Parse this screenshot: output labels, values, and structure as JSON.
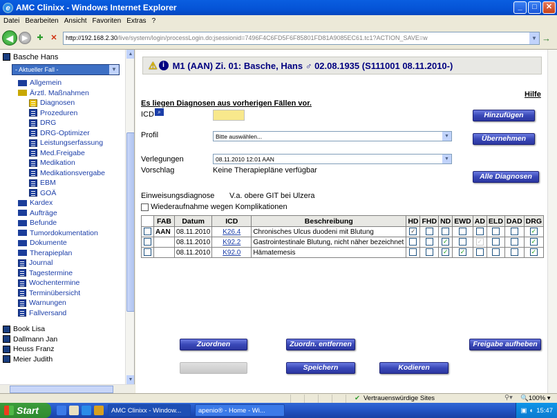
{
  "window": {
    "title": "AMC Clinixx - Windows Internet Explorer"
  },
  "menu": [
    "Datei",
    "Bearbeiten",
    "Ansicht",
    "Favoriten",
    "Extras",
    "?"
  ],
  "address": {
    "host": "http://192.168.2.30",
    "path": "/live/system/login/processLogin.do;jsessionid=7496F4C6FD5F6F85801FD81A9085EC61.tc1?ACTION_SAVE=w"
  },
  "sidebar": {
    "patient": "Basche Hans",
    "case_select": "- Aktueller Fall -",
    "items": [
      {
        "label": "Allgemein"
      },
      {
        "label": "Ärztl. Maßnahmen"
      },
      {
        "label": "Diagnosen"
      },
      {
        "label": "Prozeduren"
      },
      {
        "label": "DRG"
      },
      {
        "label": "DRG-Optimizer"
      },
      {
        "label": "Leistungserfassung"
      },
      {
        "label": "Med.Freigabe"
      },
      {
        "label": "Medikation"
      },
      {
        "label": "Medikationsvergabe"
      },
      {
        "label": "EBM"
      },
      {
        "label": "GOÄ"
      },
      {
        "label": "Kardex"
      },
      {
        "label": "Aufträge"
      },
      {
        "label": "Befunde"
      },
      {
        "label": "Tumordokumentation"
      },
      {
        "label": "Dokumente"
      },
      {
        "label": "Therapieplan"
      },
      {
        "label": "Journal"
      },
      {
        "label": "Tagestermine"
      },
      {
        "label": "Wochentermine"
      },
      {
        "label": "Terminübersicht"
      },
      {
        "label": "Warnungen"
      },
      {
        "label": "Fallversand"
      }
    ],
    "patients": [
      "Book Lisa",
      "Dallmann Jan",
      "Heuss Franz",
      "Meier Judith"
    ]
  },
  "header": {
    "title": "M1 (AAN) Zi. 01: Basche, Hans ♂ 02.08.1935 (S111001 08.11.2010-)"
  },
  "form": {
    "prev_diag_link": "Es liegen Diagnosen aus vorherigen Fällen vor.",
    "help_link": "Hilfe",
    "icd_label": "ICD",
    "profil_label": "Profil",
    "profil_value": "Bitte auswählen...",
    "verlegungen_label": "Verlegungen",
    "verlegungen_value": "08.11.2010 12:01 AAN",
    "vorschlag_label": "Vorschlag",
    "vorschlag_value": "Keine Therapiepläne verfügbar",
    "einweisung_label": "Einweisungsdiagnose",
    "einweisung_value": "V.a. obere GIT bei Ulzera",
    "wiederaufnahme_label": "Wiederaufnahme wegen Komplikationen",
    "btn_hinzufuegen": "Hinzufügen",
    "btn_uebernehmen": "Übernehmen",
    "btn_alle_diagnosen": "Alle Diagnosen"
  },
  "table": {
    "headers": [
      "FAB",
      "Datum",
      "ICD",
      "Beschreibung",
      "HD",
      "FHD",
      "ND",
      "EWD",
      "AD",
      "ELD",
      "DAD",
      "DRG"
    ],
    "rows": [
      {
        "fab": "AAN",
        "datum": "08.11.2010",
        "icd": "K26.4",
        "beschreibung": "Chronisches Ulcus duodeni mit Blutung",
        "flags": [
          "✓",
          "",
          "",
          "",
          "",
          "",
          "",
          "✓"
        ]
      },
      {
        "fab": "",
        "datum": "08.11.2010",
        "icd": "K92.2",
        "beschreibung": "Gastrointestinale Blutung, nicht näher bezeichnet",
        "flags": [
          "",
          "",
          "✓",
          "",
          "✓",
          "",
          "",
          "✓"
        ]
      },
      {
        "fab": "",
        "datum": "08.11.2010",
        "icd": "K92.0",
        "beschreibung": "Hämatemesis",
        "flags": [
          "",
          "",
          "✓",
          "✓",
          "",
          "",
          "",
          "✓"
        ]
      }
    ]
  },
  "buttons": {
    "zuordnen": "Zuordnen",
    "zuordn_entfernen": "Zuordn. entfernen",
    "freigabe_aufheben": "Freigabe aufheben",
    "speichern": "Speichern",
    "kodieren": "Kodieren"
  },
  "statusbar": {
    "zone": "Vertrauenswürdige Sites",
    "zoom": "100%"
  },
  "taskbar": {
    "start": "Start",
    "tasks": [
      "AMC Clinixx - Window...",
      "apenio® - Home - Wi..."
    ],
    "clock": "15:47"
  },
  "colors": {
    "accent": "#1b3ea8",
    "title_blue": "#000080",
    "button_blue": "#3a48b8",
    "icd_field": "#f8e88c"
  }
}
